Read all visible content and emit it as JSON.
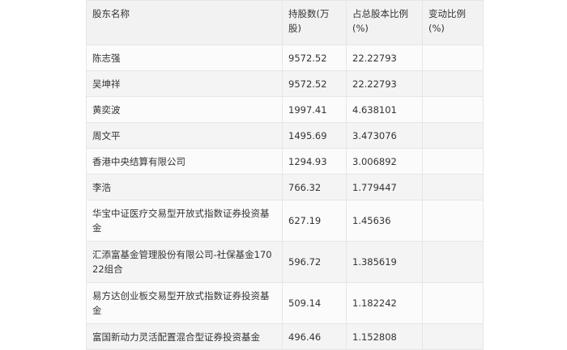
{
  "table": {
    "headers": {
      "name": "股东名称",
      "shares": "持股数(万股)",
      "ratio": "占总股本比例(%)",
      "change": "变动比例(%)"
    },
    "rows": [
      {
        "name": "陈志强",
        "shares": "9572.52",
        "ratio": "22.22793",
        "change": ""
      },
      {
        "name": "吴坤祥",
        "shares": "9572.52",
        "ratio": "22.22793",
        "change": ""
      },
      {
        "name": "黄奕波",
        "shares": "1997.41",
        "ratio": "4.638101",
        "change": ""
      },
      {
        "name": "周文平",
        "shares": "1495.69",
        "ratio": "3.473076",
        "change": ""
      },
      {
        "name": "香港中央结算有限公司",
        "shares": "1294.93",
        "ratio": "3.006892",
        "change": ""
      },
      {
        "name": "李浩",
        "shares": "766.32",
        "ratio": "1.779447",
        "change": ""
      },
      {
        "name": "华宝中证医疗交易型开放式指数证券投资基金",
        "shares": "627.19",
        "ratio": "1.45636",
        "change": ""
      },
      {
        "name": "汇添富基金管理股份有限公司-社保基金17022组合",
        "shares": "596.72",
        "ratio": "1.385619",
        "change": ""
      },
      {
        "name": "易方达创业板交易型开放式指数证券投资基金",
        "shares": "509.14",
        "ratio": "1.182242",
        "change": ""
      },
      {
        "name": "富国新动力灵活配置混合型证券投资基金",
        "shares": "496.46",
        "ratio": "1.152808",
        "change": ""
      }
    ]
  }
}
